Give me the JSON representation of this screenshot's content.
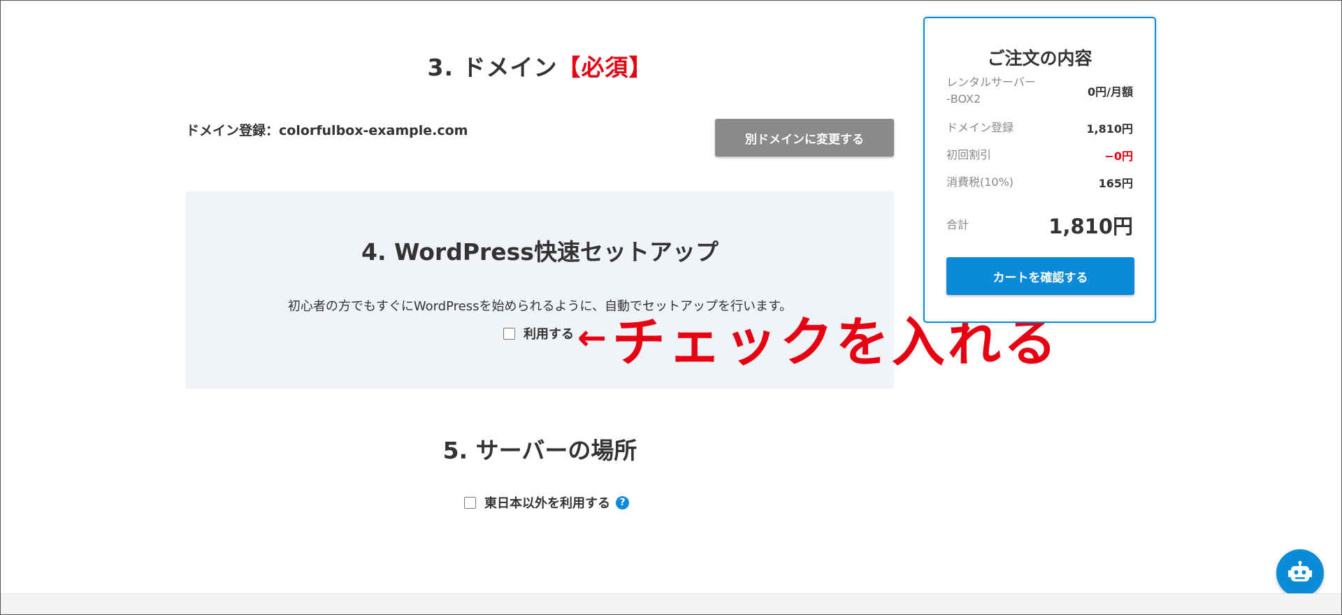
{
  "section3": {
    "title_main": "3. ドメイン",
    "title_required": "【必須】",
    "domain_label": "ドメイン登録：",
    "domain_value": "colorfulbox-example.com",
    "change_button": "別ドメインに変更する"
  },
  "section4": {
    "title": "4. WordPress快速セットアップ",
    "description": "初心者の方でもすぐにWordPressを始められるように、自動でセットアップを行います。",
    "checkbox_label": "利用する",
    "checkbox_checked": false
  },
  "annotation": {
    "arrow": "←",
    "text": "チェックを入れる",
    "color": "#e60012"
  },
  "section5": {
    "title": "5. サーバーの場所",
    "checkbox_label": "東日本以外を利用する",
    "checkbox_checked": false,
    "help_icon": "question-circle-icon"
  },
  "order_summary": {
    "title": "ご注文の内容",
    "items": [
      {
        "label": "レンタルサーバー\n-BOX2",
        "value": "0円/月額"
      },
      {
        "label": "ドメイン登録",
        "value": "1,810円"
      },
      {
        "label": "初回割引",
        "value": "−0円"
      },
      {
        "label": "消費税(10%)",
        "value": "165円"
      }
    ],
    "total_label": "合計",
    "total_value": "1,810円",
    "cart_button": "カートを確認する"
  },
  "chat_bot": {
    "icon": "robot-icon"
  },
  "colors": {
    "accent": "#0a8ad8",
    "required_red": "#e60012",
    "secondary_button": "#8a8a8a",
    "panel_background": "#f0f3f8"
  }
}
